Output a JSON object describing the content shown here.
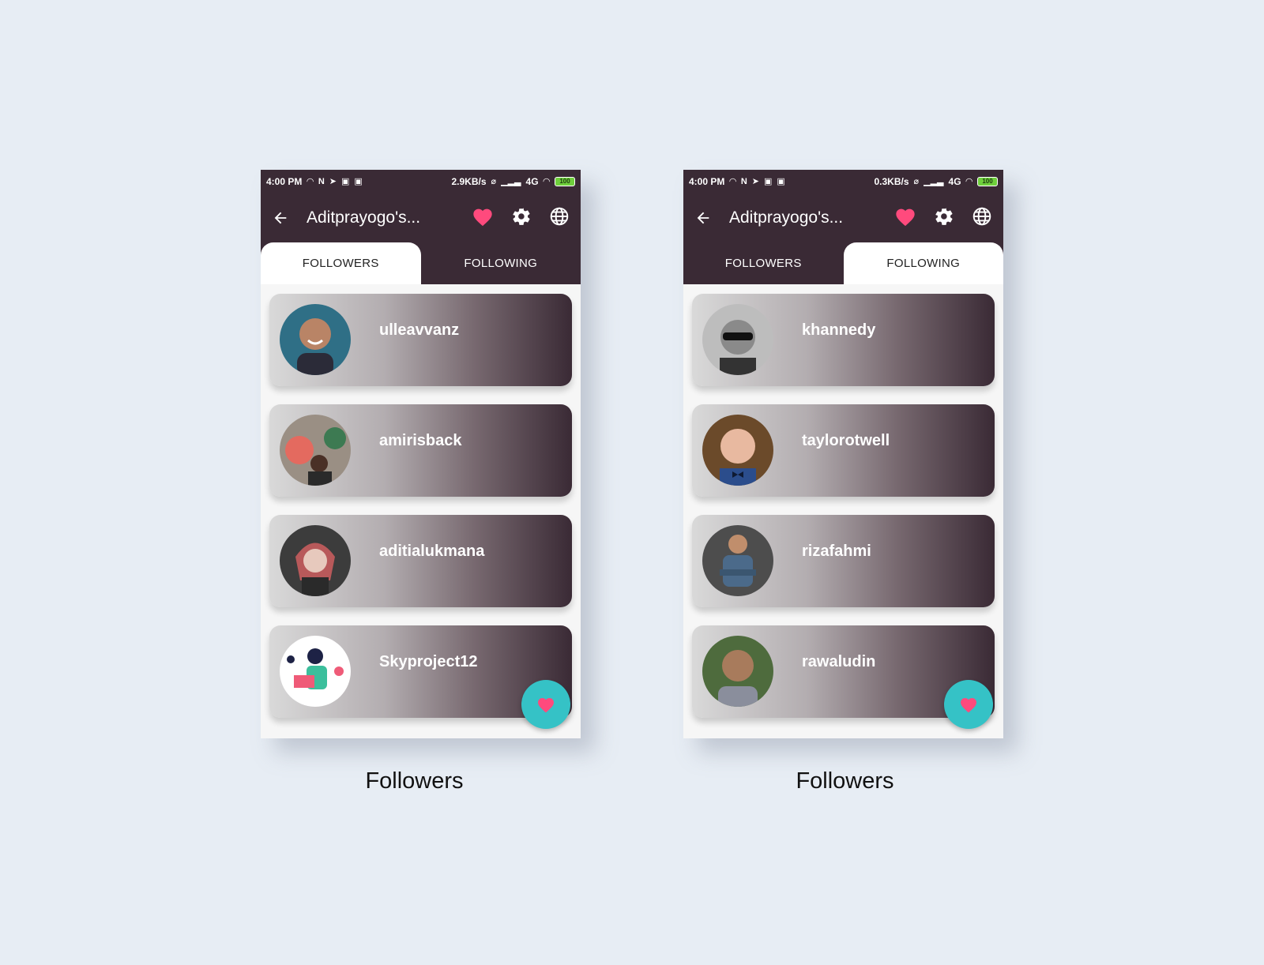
{
  "colors": {
    "primary": "#3a2a35",
    "accent_heart": "#ff4a7d",
    "fab": "#35c2c6",
    "background": "#e7edf4"
  },
  "screens": [
    {
      "status": {
        "time": "4:00 PM",
        "speed": "2.9KB/s",
        "network": "4G",
        "battery": "100"
      },
      "appbar": {
        "title": "Aditprayogo's...",
        "icons": [
          "back-arrow-icon",
          "heart-icon",
          "gear-icon",
          "globe-icon"
        ]
      },
      "tabs": [
        {
          "label": "FOLLOWERS",
          "active": true
        },
        {
          "label": "FOLLOWING",
          "active": false
        }
      ],
      "users": [
        "ulleavvanz",
        "amirisback",
        "aditialukmana",
        "Skyproject12"
      ],
      "caption": "Followers"
    },
    {
      "status": {
        "time": "4:00 PM",
        "speed": "0.3KB/s",
        "network": "4G",
        "battery": "100"
      },
      "appbar": {
        "title": "Aditprayogo's...",
        "icons": [
          "back-arrow-icon",
          "heart-icon",
          "gear-icon",
          "globe-icon"
        ]
      },
      "tabs": [
        {
          "label": "FOLLOWERS",
          "active": false
        },
        {
          "label": "FOLLOWING",
          "active": true
        }
      ],
      "users": [
        "khannedy",
        "taylorotwell",
        "rizafahmi",
        "rawaludin"
      ],
      "caption": "Followers"
    }
  ]
}
